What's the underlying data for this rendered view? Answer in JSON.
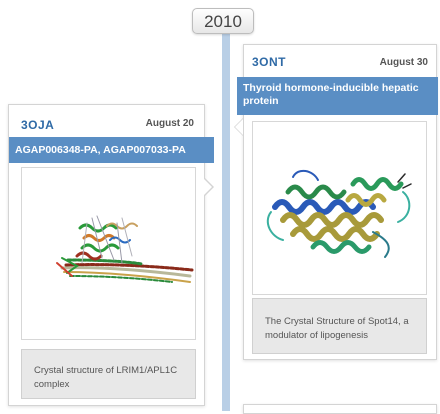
{
  "timeline": {
    "year": "2010"
  },
  "entries": [
    {
      "pdb_id": "3OJA",
      "date": "August 20",
      "title": "AGAP006348-PA, AGAP007033-PA",
      "caption": "Crystal structure of LRIM1/APL1C complex",
      "image_icon": "protein-structure-image"
    },
    {
      "pdb_id": "3ONT",
      "date": "August 30",
      "title": "Thyroid hormone-inducible hepatic protein",
      "caption": "The Crystal Structure of Spot14, a modulator of lipogenesis",
      "image_icon": "protein-structure-image"
    }
  ],
  "colors": {
    "accent": "#5a8ec4",
    "id_text": "#2f6aa6",
    "timeline": "#b9cfe6",
    "caption_bg": "#e8e8e8"
  }
}
